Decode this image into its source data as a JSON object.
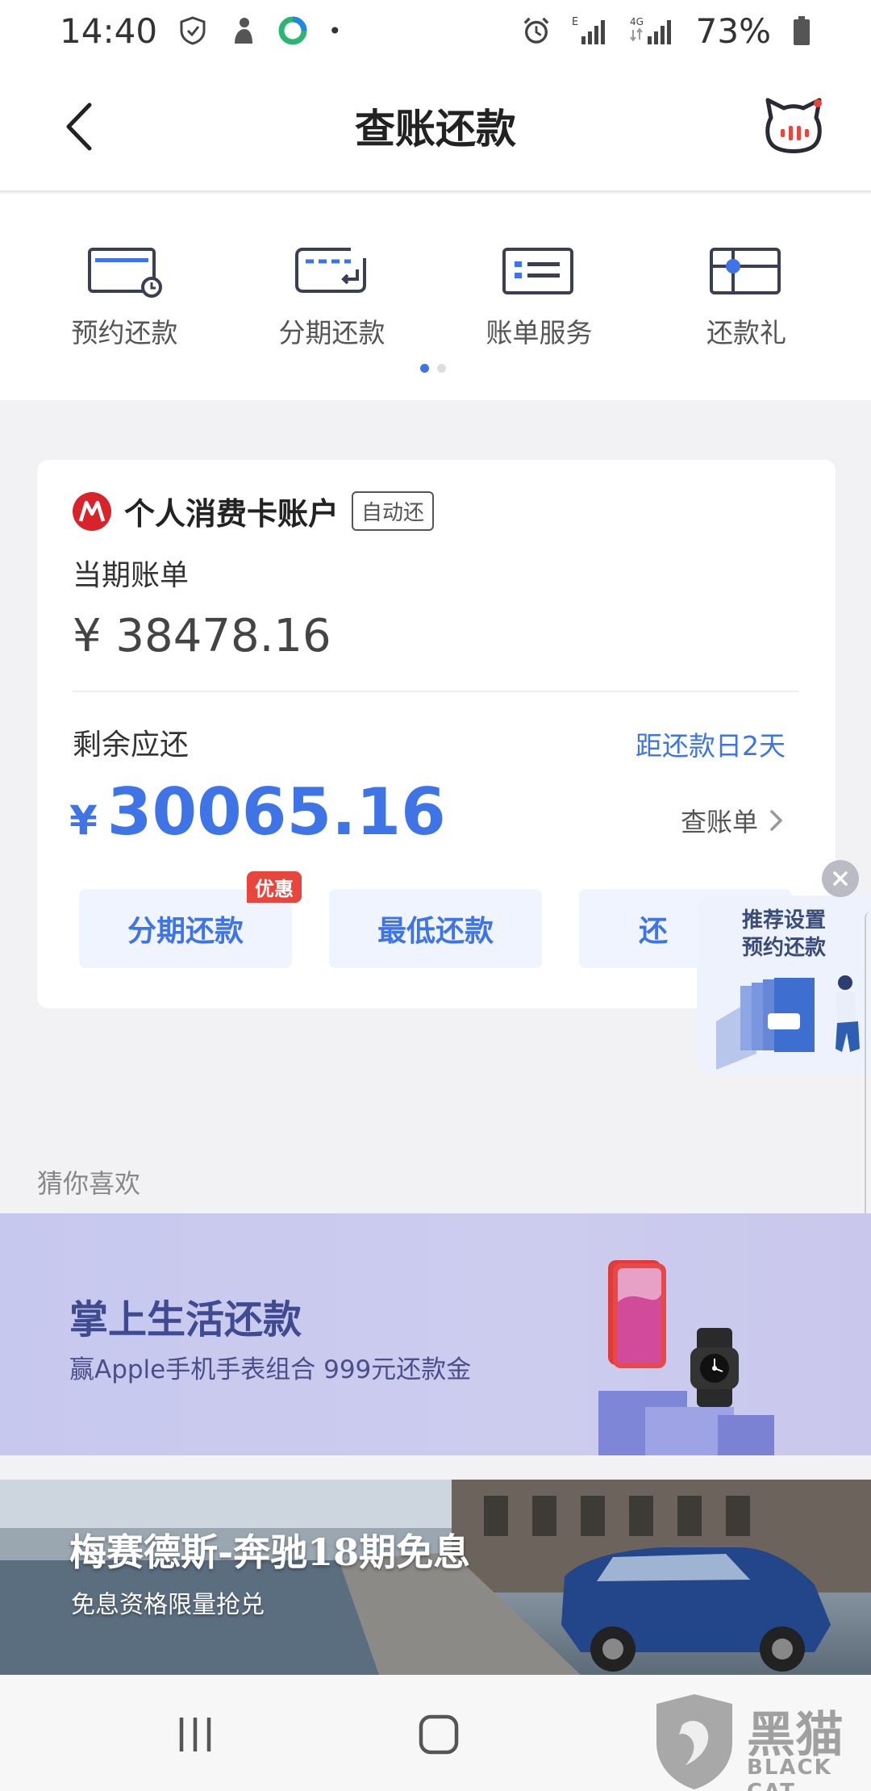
{
  "status_bar": {
    "time": "14:40",
    "battery": "73%",
    "network_e": "E",
    "network_4g": "4G"
  },
  "nav": {
    "title": "查账还款"
  },
  "services": [
    {
      "label": "预约还款",
      "icon": "schedule-card-icon"
    },
    {
      "label": "分期还款",
      "icon": "installment-card-icon"
    },
    {
      "label": "账单服务",
      "icon": "bill-service-icon"
    },
    {
      "label": "还款礼",
      "icon": "repay-gift-icon"
    }
  ],
  "card": {
    "account_name": "个人消费卡账户",
    "auto_tag": "自动还",
    "current_bill_label": "当期账单",
    "current_bill_amount": "¥ 38478.16",
    "remaining_label": "剩余应还",
    "due_text": "距还款日2天",
    "remaining_currency": "¥",
    "remaining_amount": "30065.16",
    "view_bill": "查账单",
    "buttons": [
      "分期还款",
      "最低还款",
      "还"
    ],
    "promo_tag": "优惠"
  },
  "float_ad": {
    "line1": "推荐设置",
    "line2": "预约还款"
  },
  "recommend": {
    "title": "猜你喜欢",
    "banner1_title": "掌上生活还款",
    "banner1_sub": "赢Apple手机手表组合 999元还款金",
    "banner2_title": "梅赛德斯-奔驰18期免息",
    "banner2_sub": "免息资格限量抢兑"
  },
  "watermark": {
    "text": "黑猫",
    "sub": "BLACK CAT"
  },
  "colors": {
    "accent": "#3e74e6",
    "promo": "#e8453c",
    "bank_red": "#d8232a"
  }
}
